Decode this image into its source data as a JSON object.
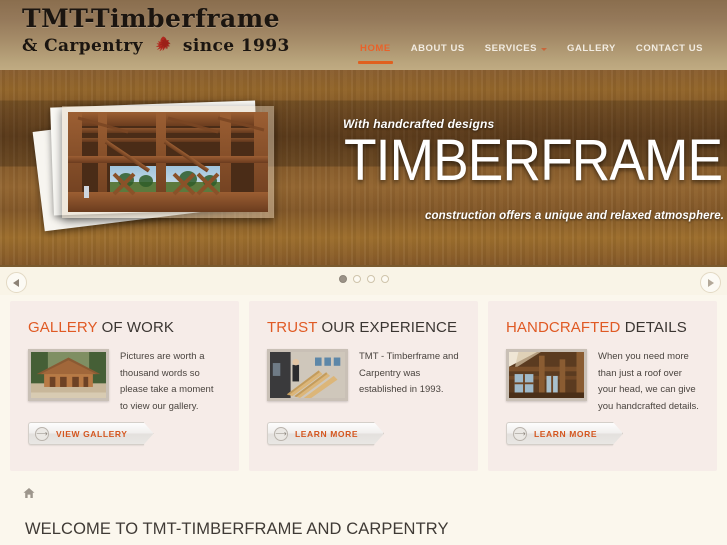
{
  "header": {
    "logo": {
      "line1": "TMT-Timberframe",
      "line2_left": "& Carpentry",
      "line2_right": "since 1993",
      "crest_icon": "griffin-crest-icon"
    },
    "nav": [
      {
        "label": "HOME",
        "active": true,
        "has_dropdown": false
      },
      {
        "label": "ABOUT US",
        "active": false,
        "has_dropdown": false
      },
      {
        "label": "SERVICES",
        "active": false,
        "has_dropdown": true
      },
      {
        "label": "GALLERY",
        "active": false,
        "has_dropdown": false
      },
      {
        "label": "CONTACT US",
        "active": false,
        "has_dropdown": false
      }
    ],
    "accent_color": "#e0601f"
  },
  "hero": {
    "kicker": "With handcrafted designs",
    "title": "TIMBERFRAME",
    "subtitle": "construction offers a unique and relaxed atmosphere.",
    "photo_alt": "timber frame barn interior photo"
  },
  "slider": {
    "prev_icon": "chevron-left-icon",
    "next_icon": "chevron-right-icon",
    "dot_count": 4,
    "active_dot": 1
  },
  "cards": [
    {
      "title_highlight": "GALLERY",
      "title_rest": " OF WORK",
      "text": "Pictures are worth a thousand words so please take a moment to view our gallery.",
      "button": "VIEW GALLERY",
      "button_icon": "arrow-right-circle-icon",
      "thumb_alt": "wooden lodge exterior"
    },
    {
      "title_highlight": "TRUST",
      "title_rest": " OUR EXPERIENCE",
      "text": "TMT - Timberframe and Carpentry was established in 1993.",
      "button": "LEARN MORE",
      "button_icon": "arrow-right-circle-icon",
      "thumb_alt": "carpenter working on roof trusses"
    },
    {
      "title_highlight": "HANDCRAFTED",
      "title_rest": " DETAILS",
      "text": "When you need more than just a roof over your head, we can give you handcrafted details.",
      "button": "LEARN MORE",
      "button_icon": "arrow-right-circle-icon",
      "thumb_alt": "handcrafted timber interior detail"
    }
  ],
  "bottom": {
    "breadcrumb_icon": "home-icon",
    "welcome_heading": "WELCOME TO TMT-TIMBERFRAME AND CARPENTRY"
  }
}
